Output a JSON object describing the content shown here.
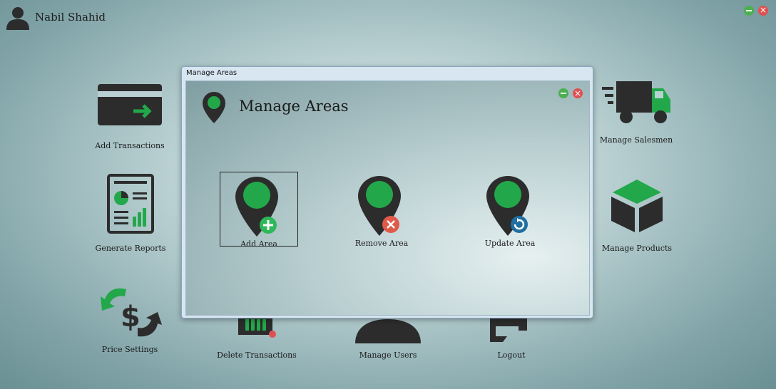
{
  "user": {
    "name": "Nabil Shahid",
    "icon": "user-icon"
  },
  "window": {
    "minimize_icon": "minimize-icon",
    "close_icon": "close-icon"
  },
  "tiles": {
    "add_transactions": "Add Transactions",
    "manage_salesmen": "Manage Salesmen",
    "generate_reports": "Generate Reports",
    "manage_products": "Manage Products",
    "price_settings": "Price Settings",
    "delete_transactions": "Delete Transactions",
    "manage_users": "Manage Users",
    "logout": "Logout"
  },
  "dialog": {
    "window_title": "Manage Areas",
    "heading": "Manage Areas",
    "actions": {
      "add": "Add Area",
      "remove": "Remove Area",
      "update": "Update Area"
    }
  },
  "colors": {
    "accent_green": "#22a84a",
    "dark_icon": "#2c2c2c",
    "remove_red": "#e05a4a",
    "update_blue": "#1f6fa0"
  }
}
